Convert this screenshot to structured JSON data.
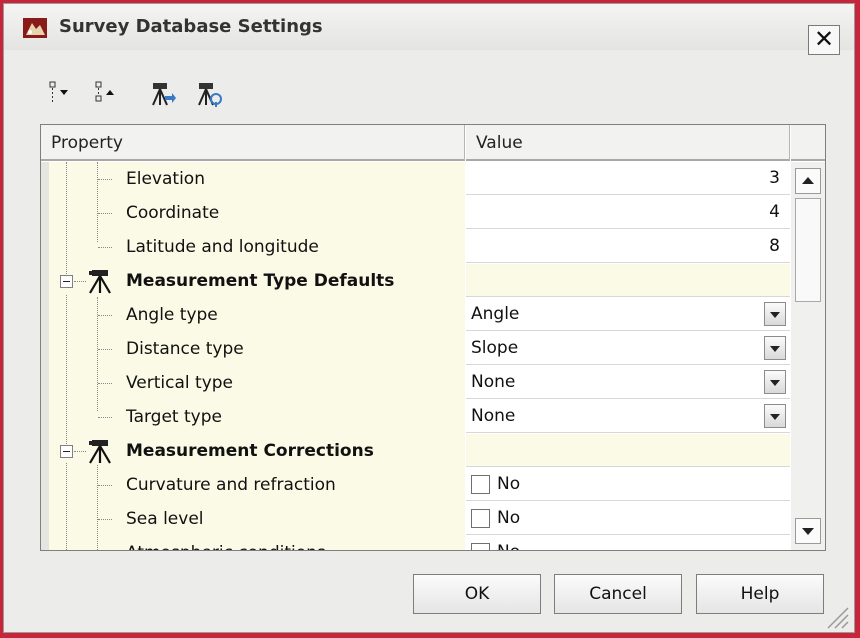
{
  "window": {
    "title": "Survey Database Settings",
    "close_glyph": "✕"
  },
  "toolbar": {
    "buttons": [
      {
        "icon": "expand-all-icon"
      },
      {
        "icon": "collapse-all-icon"
      },
      {
        "icon": "survey-instrument-import-icon"
      },
      {
        "icon": "survey-instrument-settings-icon"
      }
    ]
  },
  "grid": {
    "headers": {
      "property": "Property",
      "value": "Value"
    },
    "rows": [
      {
        "type": "item",
        "name": "Elevation",
        "value": "3"
      },
      {
        "type": "item",
        "name": "Coordinate",
        "value": "4"
      },
      {
        "type": "item",
        "name": "Latitude and longitude",
        "value": "8"
      },
      {
        "type": "category",
        "name": "Measurement Type Defaults"
      },
      {
        "type": "select",
        "name": "Angle type",
        "value": "Angle"
      },
      {
        "type": "select",
        "name": "Distance type",
        "value": "Slope"
      },
      {
        "type": "select",
        "name": "Vertical type",
        "value": "None"
      },
      {
        "type": "select",
        "name": "Target type",
        "value": "None"
      },
      {
        "type": "category",
        "name": "Measurement Corrections"
      },
      {
        "type": "check",
        "name": "Curvature and refraction",
        "value": "No"
      },
      {
        "type": "check",
        "name": "Sea level",
        "value": "No"
      },
      {
        "type": "check",
        "name": "Atmospheric conditions",
        "value": "No"
      }
    ]
  },
  "buttons": {
    "ok": "OK",
    "cancel": "Cancel",
    "help": "Help"
  },
  "colors": {
    "frame": "#c8243a",
    "tree_background": "#fafae6"
  }
}
